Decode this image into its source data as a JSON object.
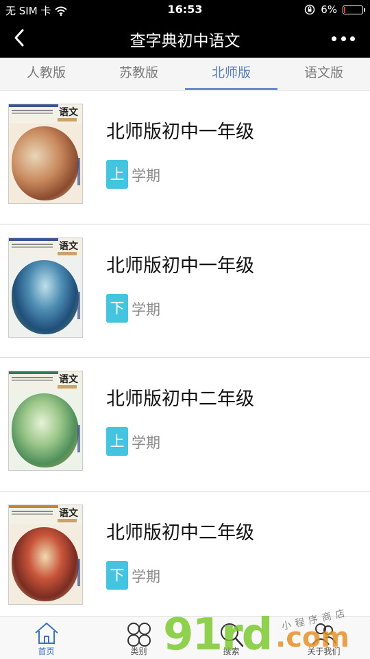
{
  "status_bar": {
    "carrier": "无 SIM 卡",
    "time": "16:53",
    "battery_percent": "6%",
    "battery_level": 0.06
  },
  "nav": {
    "title": "查字典初中语文"
  },
  "tabs": [
    {
      "label": "人教版",
      "active": false
    },
    {
      "label": "苏教版",
      "active": false
    },
    {
      "label": "北师版",
      "active": true
    },
    {
      "label": "语文版",
      "active": false
    }
  ],
  "books": [
    {
      "title": "北师版初中一年级",
      "term_badge": "上",
      "term_label": "学期",
      "cover_text": "语文"
    },
    {
      "title": "北师版初中一年级",
      "term_badge": "下",
      "term_label": "学期",
      "cover_text": "语文"
    },
    {
      "title": "北师版初中二年级",
      "term_badge": "上",
      "term_label": "学期",
      "cover_text": "语文"
    },
    {
      "title": "北师版初中二年级",
      "term_badge": "下",
      "term_label": "学期",
      "cover_text": "语文"
    }
  ],
  "bottom_nav": [
    {
      "label": "首页",
      "icon": "home-icon",
      "active": true
    },
    {
      "label": "类别",
      "icon": "category-icon",
      "active": false
    },
    {
      "label": "搜索",
      "icon": "search-icon",
      "active": false
    },
    {
      "label": "关于我们",
      "icon": "about-us-icon",
      "active": false
    }
  ],
  "watermark": {
    "brand": "91rd",
    "domain": ".com",
    "signature": "小程序商店"
  },
  "colors": {
    "accent": "#5b7fbd",
    "badge": "#45c4e0",
    "header_bg": "#000000"
  }
}
